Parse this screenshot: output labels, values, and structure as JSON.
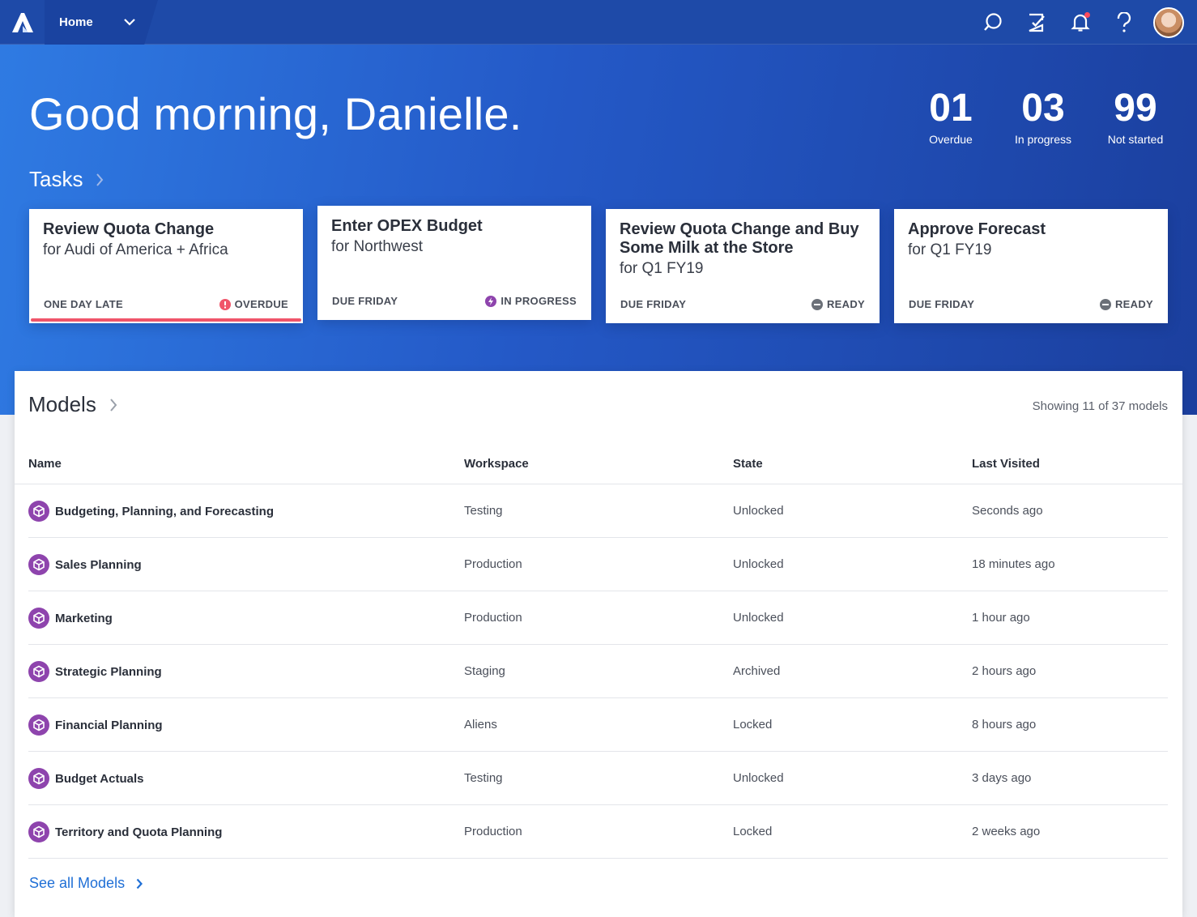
{
  "nav": {
    "home_label": "Home",
    "icons": [
      "search-icon",
      "tasks-check-icon",
      "bell-icon",
      "help-icon"
    ],
    "notification_dot_color": "#ff4b5c"
  },
  "hero": {
    "greeting": "Good morning, Danielle.",
    "tasks_title": "Tasks",
    "stats": [
      {
        "value": "01",
        "label": "Overdue"
      },
      {
        "value": "03",
        "label": "In progress"
      },
      {
        "value": "99",
        "label": "Not started"
      }
    ]
  },
  "tasks": [
    {
      "title": "Review Quota Change",
      "subtitle": "for Audi of America + Africa",
      "due": "ONE DAY LATE",
      "status": "OVERDUE",
      "status_color": "#f0556a"
    },
    {
      "title": "Enter OPEX Budget",
      "subtitle": "for Northwest",
      "due": "DUE FRIDAY",
      "status": "IN PROGRESS",
      "status_color": "#8e44ad"
    },
    {
      "title": "Review Quota Change and Buy Some Milk at the Store",
      "subtitle": "for Q1 FY19",
      "due": "DUE FRIDAY",
      "status": "READY",
      "status_color": "#6b7078"
    },
    {
      "title": "Approve Forecast",
      "subtitle": "for Q1 FY19",
      "due": "DUE FRIDAY",
      "status": "READY",
      "status_color": "#6b7078"
    }
  ],
  "models": {
    "title": "Models",
    "showing": "Showing 11 of 37 models",
    "columns": [
      "Name",
      "Workspace",
      "State",
      "Last Visited"
    ],
    "rows": [
      {
        "name": "Budgeting, Planning, and Forecasting",
        "workspace": "Testing",
        "state": "Unlocked",
        "last_visited": "Seconds ago"
      },
      {
        "name": "Sales Planning",
        "workspace": "Production",
        "state": "Unlocked",
        "last_visited": "18 minutes ago"
      },
      {
        "name": "Marketing",
        "workspace": "Production",
        "state": "Unlocked",
        "last_visited": "1 hour ago"
      },
      {
        "name": "Strategic Planning",
        "workspace": "Staging",
        "state": "Archived",
        "last_visited": "2 hours ago"
      },
      {
        "name": "Financial Planning",
        "workspace": "Aliens",
        "state": "Locked",
        "last_visited": "8 hours ago"
      },
      {
        "name": "Budget Actuals",
        "workspace": "Testing",
        "state": "Unlocked",
        "last_visited": "3 days ago"
      },
      {
        "name": "Territory and Quota Planning",
        "workspace": "Production",
        "state": "Locked",
        "last_visited": "2 weeks ago"
      }
    ],
    "see_all": "See all Models",
    "model_icon_color": "#8e44ad",
    "link_color": "#1f6fd6"
  }
}
